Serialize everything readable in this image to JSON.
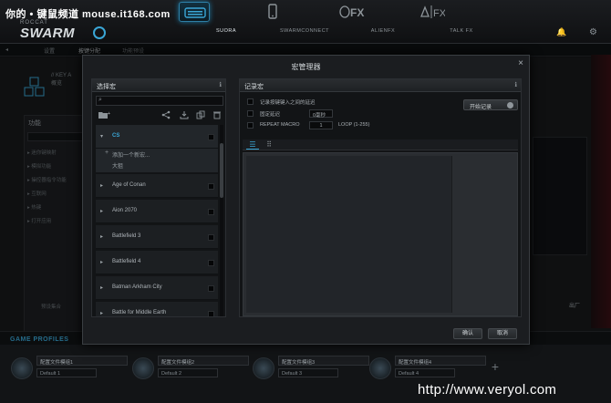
{
  "watermark_top": "你的 • 键鼠频道 mouse.it168.com",
  "watermark_bottom": "http://www.veryol.com",
  "brand": {
    "roccat": "ROCCAT",
    "swarm": "SWARM"
  },
  "nav": [
    {
      "label": "SUORA",
      "icon": "keyboard-icon",
      "active": true
    },
    {
      "label": "SWARMCONNECT",
      "icon": "phone-icon",
      "active": false
    },
    {
      "label": "ALIENFX",
      "icon": "alien-icon",
      "active": false
    },
    {
      "label": "TALK FX",
      "icon": "talkfx-icon",
      "active": false
    }
  ],
  "subtabs": [
    "设置",
    "按键分配",
    "功能预设"
  ],
  "background": {
    "key_assign": "// KEY A",
    "key_sub": "概览",
    "func_title": "功能",
    "func_rows": [
      "▸ 迷你键映射",
      "▸ 模拟功能",
      "▸ 操控器指令功能",
      "▸ 互联网",
      "▸ 热键",
      "▸ 打开应用"
    ],
    "preset": "预设集合",
    "right_hint": "出厂"
  },
  "dialog": {
    "title": "宏管理器",
    "close": "×",
    "left_panel": {
      "title": "选择宏",
      "info": "ℹ",
      "search_placeholder": "",
      "groups": [
        {
          "name": "CS",
          "open": true,
          "children": [
            "添加一个新宏...",
            "大狙"
          ]
        },
        {
          "name": "Age of Conan",
          "open": false
        },
        {
          "name": "Aion 2070",
          "open": false
        },
        {
          "name": "Battlefield 3",
          "open": false
        },
        {
          "name": "Battlefield 4",
          "open": false
        },
        {
          "name": "Batman Arkham City",
          "open": false
        },
        {
          "name": "Battle for Middle Earth",
          "open": false
        }
      ]
    },
    "right_panel": {
      "title": "记录宏",
      "info": "ℹ",
      "opt1": "记录按键键入之间的延迟",
      "opt2": "固定延迟",
      "opt2_value": "0毫秒",
      "opt3": "REPEAT MACRO",
      "opt3_value": "1",
      "opt3_hint": "LOOP (1-255)",
      "record_button": "开始记录"
    },
    "ok": "确认",
    "cancel": "取消"
  },
  "profiles": {
    "title": "GAME PROFILES",
    "slots": [
      {
        "name": "配置文件模组1",
        "default": "Default 1"
      },
      {
        "name": "配置文件模组2",
        "default": "Default 2"
      },
      {
        "name": "配置文件模组3",
        "default": "Default 3"
      },
      {
        "name": "配置文件模组4",
        "default": "Default 4"
      }
    ],
    "add": "+"
  },
  "colors": {
    "accent": "#3aa6d6",
    "panel": "#121416",
    "dialog": "#1b1d20"
  }
}
